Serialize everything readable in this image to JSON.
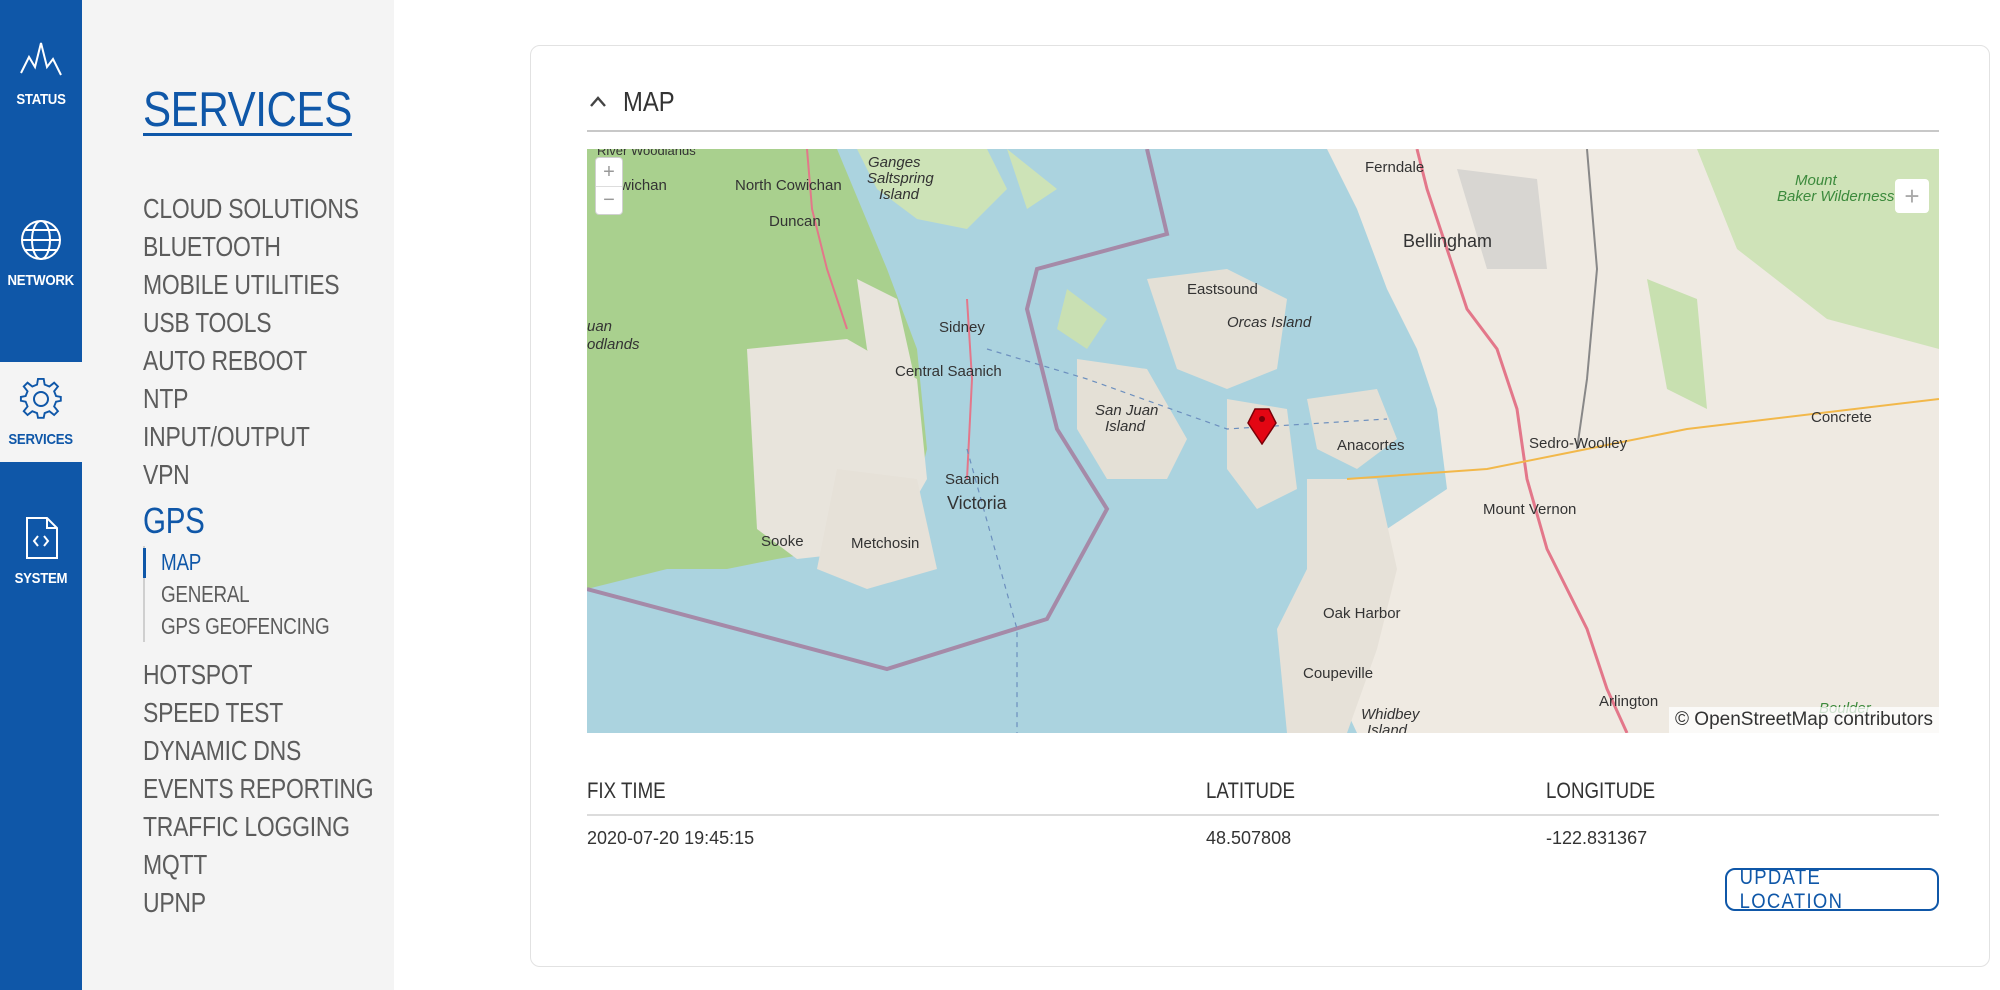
{
  "rail": {
    "items": [
      {
        "label": "STATUS",
        "icon": "status-wave-icon"
      },
      {
        "label": "NETWORK",
        "icon": "globe-icon"
      },
      {
        "label": "SERVICES",
        "icon": "gear-icon"
      },
      {
        "label": "SYSTEM",
        "icon": "code-file-icon"
      }
    ],
    "active": "SERVICES",
    "accent": "#0f57a8"
  },
  "menu": {
    "title": "SERVICES",
    "items_before": [
      "CLOUD SOLUTIONS",
      "BLUETOOTH",
      "MOBILE UTILITIES",
      "USB TOOLS",
      "AUTO REBOOT",
      "NTP",
      "INPUT/OUTPUT",
      "VPN"
    ],
    "active_item": "GPS",
    "submenu": [
      {
        "label": "MAP",
        "active": true
      },
      {
        "label": "GENERAL",
        "active": false
      },
      {
        "label": "GPS GEOFENCING",
        "active": false
      }
    ],
    "items_after": [
      "HOTSPOT",
      "SPEED TEST",
      "DYNAMIC DNS",
      "EVENTS REPORTING",
      "TRAFFIC LOGGING",
      "MQTT",
      "UPNP"
    ]
  },
  "card": {
    "title": "MAP",
    "map": {
      "zoom_in": "+",
      "zoom_out": "−",
      "fullscreen": "+",
      "attribution": "© OpenStreetMap contributors",
      "places": {
        "ganges": "Ganges",
        "saltspring": "Saltspring",
        "island": "Island",
        "cowichan": "Cowichan",
        "north_cowichan": "North Cowichan",
        "duncan": "Duncan",
        "ferndale": "Ferndale",
        "bellingham": "Bellingham",
        "mount": "Mount",
        "baker_wilderness": "Baker Wilderness",
        "eastsound": "Eastsound",
        "orcas_island": "Orcas Island",
        "sidney": "Sidney",
        "juan": "uan",
        "odlands": "odlands",
        "central_saanich": "Central Saanich",
        "san_juan": "San Juan",
        "san_juan_island": "Island",
        "anacortes": "Anacortes",
        "sedro_woolley": "Sedro-Woolley",
        "concrete": "Concrete",
        "saanich": "Saanich",
        "victoria": "Victoria",
        "mount_vernon": "Mount Vernon",
        "sooke": "Sooke",
        "metchosin": "Metchosin",
        "oak_harbor": "Oak Harbor",
        "coupeville": "Coupeville",
        "whidbey": "Whidbey",
        "whidbey_island": "Island",
        "arlington": "Arlington",
        "boulder": "Boulder",
        "river_woodlands": "River Woodlands"
      },
      "marker_color": "#e30613"
    },
    "table": {
      "headers": {
        "fix_time": "FIX TIME",
        "latitude": "LATITUDE",
        "longitude": "LONGITUDE"
      },
      "row": {
        "fix_time": "2020-07-20 19:45:15",
        "latitude": "48.507808",
        "longitude": "-122.831367"
      }
    },
    "update_button": "UPDATE LOCATION"
  }
}
